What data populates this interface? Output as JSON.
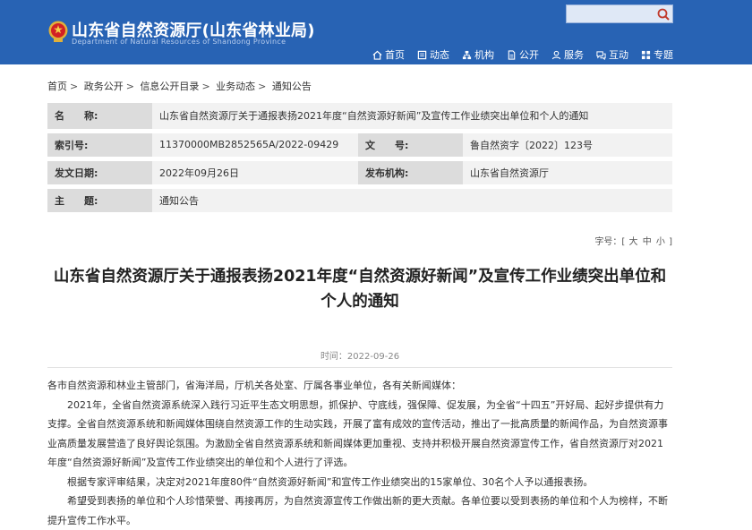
{
  "header": {
    "site_title": "山东省自然资源厅(山东省林业局)",
    "site_subtitle": "Department of Natural Resources of Shandong Province",
    "search_placeholder": "",
    "nav": [
      {
        "label": "首页",
        "icon": "home-icon"
      },
      {
        "label": "动态",
        "icon": "news-icon"
      },
      {
        "label": "机构",
        "icon": "org-icon"
      },
      {
        "label": "公开",
        "icon": "disclosure-icon"
      },
      {
        "label": "服务",
        "icon": "service-icon"
      },
      {
        "label": "互动",
        "icon": "interaction-icon"
      },
      {
        "label": "专题",
        "icon": "topic-icon"
      }
    ]
  },
  "breadcrumb": [
    "首页",
    "政务公开",
    "信息公开目录",
    "业务动态",
    "通知公告"
  ],
  "meta": {
    "name_label": "名　　称:",
    "name_value": "山东省自然资源厅关于通报表扬2021年度“自然资源好新闻”及宣传工作业绩突出单位和个人的通知",
    "index_label": "索引号:",
    "index_value": "11370000MB2852565A/2022-09429",
    "docno_label": "文　　号:",
    "docno_value": "鲁自然资字〔2022〕123号",
    "date_label": "发文日期:",
    "date_value": "2022年09月26日",
    "issuer_label": "发布机构:",
    "issuer_value": "山东省自然资源厅",
    "topic_label": "主　　题:",
    "topic_value": "通知公告"
  },
  "fontsize": {
    "label": "字号：[",
    "large": "大",
    "medium": "中",
    "small": "小",
    "close": "]"
  },
  "article": {
    "title_line1": "山东省自然资源厅关于通报表扬2021年度“自然资源好新闻”及宣传工作业绩突出单位和",
    "title_line2": "个人的通知",
    "time": "时间：2022-09-26",
    "p1": "各市自然资源和林业主管部门，省海洋局，厅机关各处室、厅属各事业单位，各有关新闻媒体：",
    "p2": "2021年，全省自然资源系统深入践行习近平生态文明思想，抓保护、守底线，强保障、促发展，为全省“十四五”开好局、起好步提供有力支撑。全省自然资源系统和新闻媒体围绕自然资源工作的生动实践，开展了富有成效的宣传活动，推出了一批高质量的新闻作品，为自然资源事业高质量发展营造了良好舆论氛围。为激励全省自然资源系统和新闻媒体更加重视、支持并积极开展自然资源宣传工作，省自然资源厅对2021年度“自然资源好新闻”及宣传工作业绩突出的单位和个人进行了评选。",
    "p3": "根据专家评审结果，决定对2021年度80件“自然资源好新闻”和宣传工作业绩突出的15家单位、30名个人予以通报表扬。",
    "p4": "希望受到表扬的单位和个人珍惜荣誉、再接再厉，为自然资源宣传工作做出新的更大贡献。各单位要以受到表扬的单位和个人为榜样，不断提升宣传工作水平。"
  },
  "colors": {
    "header_bg": "#2863b4",
    "label_bg": "#dcdcdc",
    "value_bg": "#f2f2f2"
  }
}
